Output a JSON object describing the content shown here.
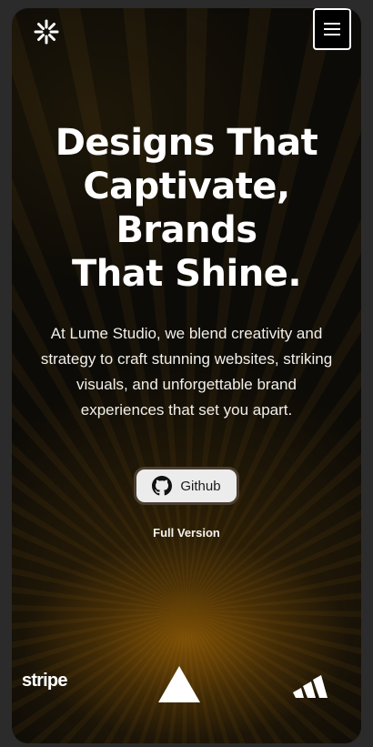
{
  "header": {
    "logo_icon": "asterisk-sunburst-icon",
    "menu_icon": "hamburger-menu-icon"
  },
  "hero": {
    "title_lines": [
      "Designs That",
      "Captivate,",
      "Brands",
      "That Shine."
    ],
    "description": "At Lume Studio, we blend creativity and strategy to craft stunning websites, striking visuals, and unforgettable brand experiences that set you apart.",
    "github_button_label": "Github",
    "github_icon": "github-icon",
    "full_version_label": "Full Version"
  },
  "partners": {
    "stripe_label": "stripe",
    "logos": [
      "stripe-logo",
      "vercel-triangle-logo",
      "adidas-logo"
    ]
  },
  "colors": {
    "background": "#0d0b07",
    "glow": "#96600a",
    "text": "#ffffff",
    "button_bg": "#ececec"
  }
}
